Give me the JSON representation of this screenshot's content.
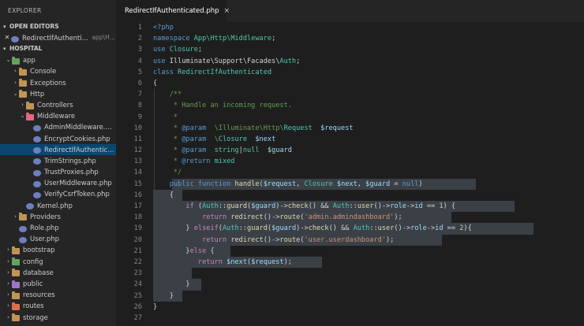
{
  "sidebar": {
    "title": "EXPLORER",
    "open_editors_label": "OPEN EDITORS",
    "open_editor_file": "RedirectIfAuthenticated.php",
    "open_editor_path": "app\\Http\\...",
    "project_label": "HOSPITAL",
    "tree": [
      {
        "label": "app",
        "type": "folder",
        "depth": 0,
        "expanded": true,
        "color": "#63a35c"
      },
      {
        "label": "Console",
        "type": "folder",
        "depth": 1,
        "expanded": false,
        "color": "#c09553"
      },
      {
        "label": "Exceptions",
        "type": "folder",
        "depth": 1,
        "expanded": false,
        "color": "#c09553"
      },
      {
        "label": "Http",
        "type": "folder",
        "depth": 1,
        "expanded": true,
        "color": "#c09553"
      },
      {
        "label": "Controllers",
        "type": "folder",
        "depth": 2,
        "expanded": false,
        "color": "#c09553"
      },
      {
        "label": "Middleware",
        "type": "folder",
        "depth": 2,
        "expanded": true,
        "color": "#e8677a"
      },
      {
        "label": "AdminMiddleware.php",
        "type": "file",
        "depth": 3
      },
      {
        "label": "EncryptCookies.php",
        "type": "file",
        "depth": 3
      },
      {
        "label": "RedirectIfAuthenticated.php",
        "type": "file",
        "depth": 3,
        "selected": true
      },
      {
        "label": "TrimStrings.php",
        "type": "file",
        "depth": 3
      },
      {
        "label": "TrustProxies.php",
        "type": "file",
        "depth": 3
      },
      {
        "label": "UserMiddleware.php",
        "type": "file",
        "depth": 3
      },
      {
        "label": "VerifyCsrfToken.php",
        "type": "file",
        "depth": 3
      },
      {
        "label": "Kernel.php",
        "type": "file",
        "depth": 2
      },
      {
        "label": "Providers",
        "type": "folder",
        "depth": 1,
        "expanded": false,
        "color": "#c09553"
      },
      {
        "label": "Role.php",
        "type": "file",
        "depth": 1
      },
      {
        "label": "User.php",
        "type": "file",
        "depth": 1
      },
      {
        "label": "bootstrap",
        "type": "folder",
        "depth": 0,
        "expanded": false,
        "color": "#c09553"
      },
      {
        "label": "config",
        "type": "folder",
        "depth": 0,
        "expanded": false,
        "color": "#63a35c"
      },
      {
        "label": "database",
        "type": "folder",
        "depth": 0,
        "expanded": false,
        "color": "#c09553"
      },
      {
        "label": "public",
        "type": "folder",
        "depth": 0,
        "expanded": false,
        "color": "#a074c4"
      },
      {
        "label": "resources",
        "type": "folder",
        "depth": 0,
        "expanded": false,
        "color": "#c09553"
      },
      {
        "label": "routes",
        "type": "folder",
        "depth": 0,
        "expanded": false,
        "color": "#e06c4b"
      },
      {
        "label": "storage",
        "type": "folder",
        "depth": 0,
        "expanded": false,
        "color": "#c09553"
      }
    ]
  },
  "tab": {
    "label": "RedirectIfAuthenticated.php",
    "close_glyph": "×"
  },
  "editor": {
    "line_numbers": [
      "1",
      "2",
      "3",
      "4",
      "5",
      "6",
      "7",
      "8",
      "9",
      "10",
      "11",
      "12",
      "13",
      "14",
      "15",
      "16",
      "17",
      "18",
      "19",
      "20",
      "21",
      "22",
      "23",
      "24",
      "25",
      "26",
      "27"
    ],
    "lines": [
      [
        {
          "t": "<?php",
          "c": "php"
        }
      ],
      [
        {
          "t": "namespace ",
          "c": "k"
        },
        {
          "t": "App\\Http\\Middleware",
          "c": "t"
        },
        {
          "t": ";",
          "c": "p"
        }
      ],
      [
        {
          "t": "use ",
          "c": "k"
        },
        {
          "t": "Closure",
          "c": "t"
        },
        {
          "t": ";",
          "c": "p"
        }
      ],
      [
        {
          "t": "use ",
          "c": "k"
        },
        {
          "t": "Illuminate\\Support\\Facades\\",
          "c": "p"
        },
        {
          "t": "Auth",
          "c": "t"
        },
        {
          "t": ";",
          "c": "p"
        }
      ],
      [
        {
          "t": "class ",
          "c": "k"
        },
        {
          "t": "RedirectIfAuthenticated",
          "c": "t"
        }
      ],
      [
        {
          "t": "{",
          "c": "p"
        }
      ],
      [
        {
          "t": "    /**",
          "c": "c"
        }
      ],
      [
        {
          "t": "     * Handle an incoming request.",
          "c": "c"
        }
      ],
      [
        {
          "t": "     *",
          "c": "c"
        }
      ],
      [
        {
          "t": "     * ",
          "c": "c"
        },
        {
          "t": "@param",
          "c": "k"
        },
        {
          "t": "  \\Illuminate\\Http\\",
          "c": "c"
        },
        {
          "t": "Request",
          "c": "t"
        },
        {
          "t": "  ",
          "c": "c"
        },
        {
          "t": "$request",
          "c": "v"
        }
      ],
      [
        {
          "t": "     * ",
          "c": "c"
        },
        {
          "t": "@param",
          "c": "k"
        },
        {
          "t": "  \\",
          "c": "c"
        },
        {
          "t": "Closure",
          "c": "t"
        },
        {
          "t": "  ",
          "c": "c"
        },
        {
          "t": "$next",
          "c": "v"
        }
      ],
      [
        {
          "t": "     * ",
          "c": "c"
        },
        {
          "t": "@param",
          "c": "k"
        },
        {
          "t": "  ",
          "c": "c"
        },
        {
          "t": "string",
          "c": "t"
        },
        {
          "t": "|",
          "c": "p"
        },
        {
          "t": "null",
          "c": "t"
        },
        {
          "t": "  ",
          "c": "c"
        },
        {
          "t": "$guard",
          "c": "v"
        }
      ],
      [
        {
          "t": "     * ",
          "c": "c"
        },
        {
          "t": "@return",
          "c": "k"
        },
        {
          "t": " mixed",
          "c": "t"
        }
      ],
      [
        {
          "t": "     */",
          "c": "c"
        }
      ],
      [
        {
          "t": "    ",
          "c": "p"
        },
        {
          "t": "public ",
          "c": "k"
        },
        {
          "t": "function ",
          "c": "k"
        },
        {
          "t": "handle",
          "c": "f"
        },
        {
          "t": "(",
          "c": "p"
        },
        {
          "t": "$request",
          "c": "v"
        },
        {
          "t": ", ",
          "c": "p"
        },
        {
          "t": "Closure ",
          "c": "t"
        },
        {
          "t": "$next",
          "c": "v"
        },
        {
          "t": ", ",
          "c": "p"
        },
        {
          "t": "$guard",
          "c": "v"
        },
        {
          "t": " = ",
          "c": "p"
        },
        {
          "t": "null",
          "c": "k"
        },
        {
          "t": ")",
          "c": "p"
        }
      ],
      [
        {
          "t": "    {",
          "c": "p"
        }
      ],
      [
        {
          "t": "        ",
          "c": "p"
        },
        {
          "t": "if ",
          "c": "kc"
        },
        {
          "t": "(",
          "c": "p"
        },
        {
          "t": "Auth",
          "c": "t"
        },
        {
          "t": "::",
          "c": "p"
        },
        {
          "t": "guard",
          "c": "f"
        },
        {
          "t": "(",
          "c": "p"
        },
        {
          "t": "$guard",
          "c": "v"
        },
        {
          "t": ")->",
          "c": "p"
        },
        {
          "t": "check",
          "c": "f"
        },
        {
          "t": "() && ",
          "c": "p"
        },
        {
          "t": "Auth",
          "c": "t"
        },
        {
          "t": "::",
          "c": "p"
        },
        {
          "t": "user",
          "c": "f"
        },
        {
          "t": "()->",
          "c": "p"
        },
        {
          "t": "role",
          "c": "v"
        },
        {
          "t": "->",
          "c": "p"
        },
        {
          "t": "id",
          "c": "v"
        },
        {
          "t": " == ",
          "c": "p"
        },
        {
          "t": "1",
          "c": "n"
        },
        {
          "t": ") {",
          "c": "p"
        }
      ],
      [
        {
          "t": "            ",
          "c": "p"
        },
        {
          "t": "return ",
          "c": "kc"
        },
        {
          "t": "redirect",
          "c": "f"
        },
        {
          "t": "()->",
          "c": "p"
        },
        {
          "t": "route",
          "c": "f"
        },
        {
          "t": "(",
          "c": "p"
        },
        {
          "t": "'admin.admindashboard'",
          "c": "s"
        },
        {
          "t": ");",
          "c": "p"
        }
      ],
      [
        {
          "t": "        } ",
          "c": "p"
        },
        {
          "t": "elseif",
          "c": "kc"
        },
        {
          "t": "(",
          "c": "p"
        },
        {
          "t": "Auth",
          "c": "t"
        },
        {
          "t": "::",
          "c": "p"
        },
        {
          "t": "guard",
          "c": "f"
        },
        {
          "t": "(",
          "c": "p"
        },
        {
          "t": "$guard",
          "c": "v"
        },
        {
          "t": ")->",
          "c": "p"
        },
        {
          "t": "check",
          "c": "f"
        },
        {
          "t": "() && ",
          "c": "p"
        },
        {
          "t": "Auth",
          "c": "t"
        },
        {
          "t": "::",
          "c": "p"
        },
        {
          "t": "user",
          "c": "f"
        },
        {
          "t": "()->",
          "c": "p"
        },
        {
          "t": "role",
          "c": "v"
        },
        {
          "t": "->",
          "c": "p"
        },
        {
          "t": "id",
          "c": "v"
        },
        {
          "t": " == ",
          "c": "p"
        },
        {
          "t": "2",
          "c": "n"
        },
        {
          "t": "){",
          "c": "p"
        }
      ],
      [
        {
          "t": "            ",
          "c": "p"
        },
        {
          "t": "return ",
          "c": "kc"
        },
        {
          "t": "redirect",
          "c": "f"
        },
        {
          "t": "()->",
          "c": "p"
        },
        {
          "t": "route",
          "c": "f"
        },
        {
          "t": "(",
          "c": "p"
        },
        {
          "t": "'user.userdashboard'",
          "c": "s"
        },
        {
          "t": ");",
          "c": "p"
        }
      ],
      [
        {
          "t": "        }",
          "c": "p"
        },
        {
          "t": "else",
          "c": "kc"
        },
        {
          "t": " {",
          "c": "p"
        }
      ],
      [
        {
          "t": "           ",
          "c": "p"
        },
        {
          "t": "return ",
          "c": "kc"
        },
        {
          "t": "$next",
          "c": "v"
        },
        {
          "t": "(",
          "c": "p"
        },
        {
          "t": "$request",
          "c": "v"
        },
        {
          "t": ");",
          "c": "p"
        }
      ],
      [
        {
          "t": "",
          "c": "p"
        }
      ],
      [
        {
          "t": "        }",
          "c": "p"
        }
      ],
      [
        {
          "t": "    }",
          "c": "p"
        }
      ],
      [
        {
          "t": "}",
          "c": "p"
        }
      ],
      [
        {
          "t": "",
          "c": "p"
        }
      ]
    ]
  },
  "colors": {
    "sidebar_bg": "#252526",
    "editor_bg": "#1e1e1e",
    "selected_row": "#094771",
    "selection_bg": "#3a4148"
  }
}
